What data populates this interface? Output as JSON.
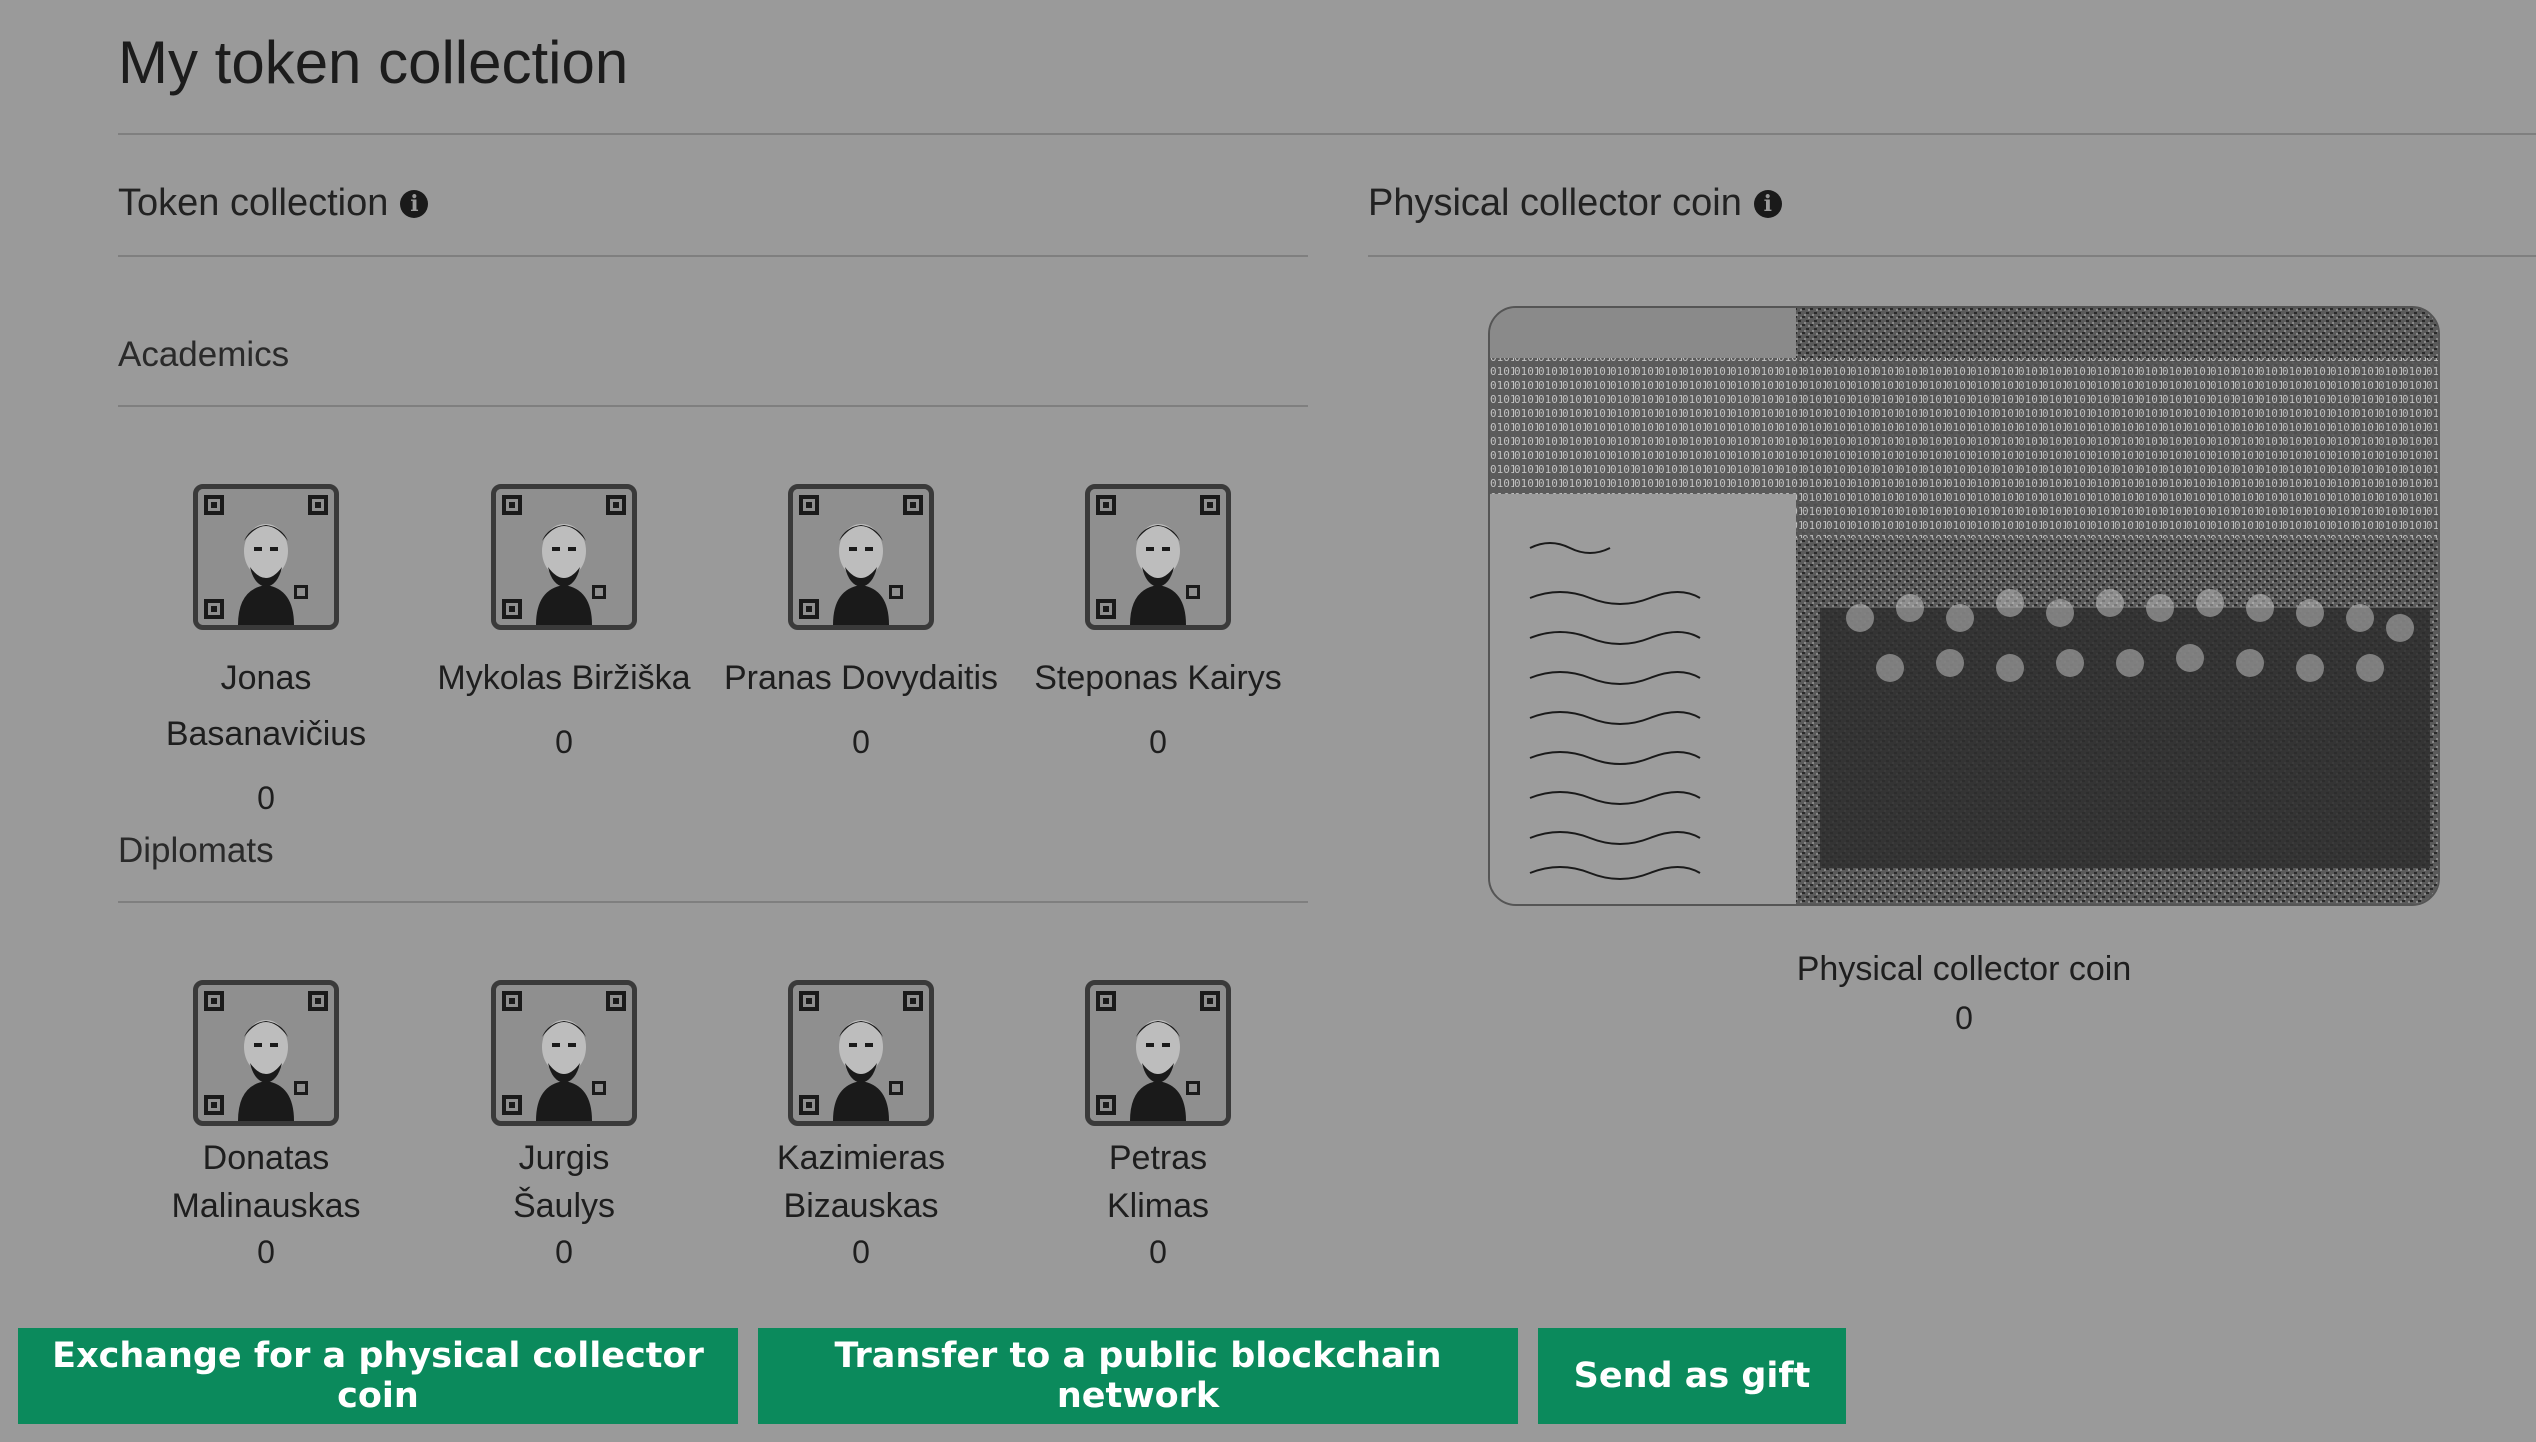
{
  "page": {
    "title": "My token collection"
  },
  "token_section": {
    "title": "Token collection",
    "info_icon": "info-icon"
  },
  "coin_section": {
    "title": "Physical collector coin",
    "info_icon": "info-icon"
  },
  "groups": [
    {
      "title": "Academics",
      "tokens": [
        {
          "name": "Jonas Basanavičius",
          "count": "0"
        },
        {
          "name": "Mykolas Biržiška",
          "count": "0"
        },
        {
          "name": "Pranas Dovydaitis",
          "count": "0"
        },
        {
          "name": "Steponas Kairys",
          "count": "0"
        }
      ]
    },
    {
      "title": "Diplomats",
      "tokens": [
        {
          "name": "Donatas Malinauskas",
          "count": "0"
        },
        {
          "name": "Jurgis Šaulys",
          "count": "0"
        },
        {
          "name": "Kazimieras Bizauskas",
          "count": "0"
        },
        {
          "name": "Petras Klimas",
          "count": "0"
        }
      ]
    }
  ],
  "coin": {
    "caption": "Physical collector coin",
    "count": "0"
  },
  "actions": {
    "exchange": "Exchange for a physical collector coin",
    "transfer": "Transfer to a public blockchain network",
    "gift": "Send as gift"
  },
  "colors": {
    "background": "#9a9a9a",
    "button": "#0b8a5c",
    "text": "#1e1e1e"
  }
}
